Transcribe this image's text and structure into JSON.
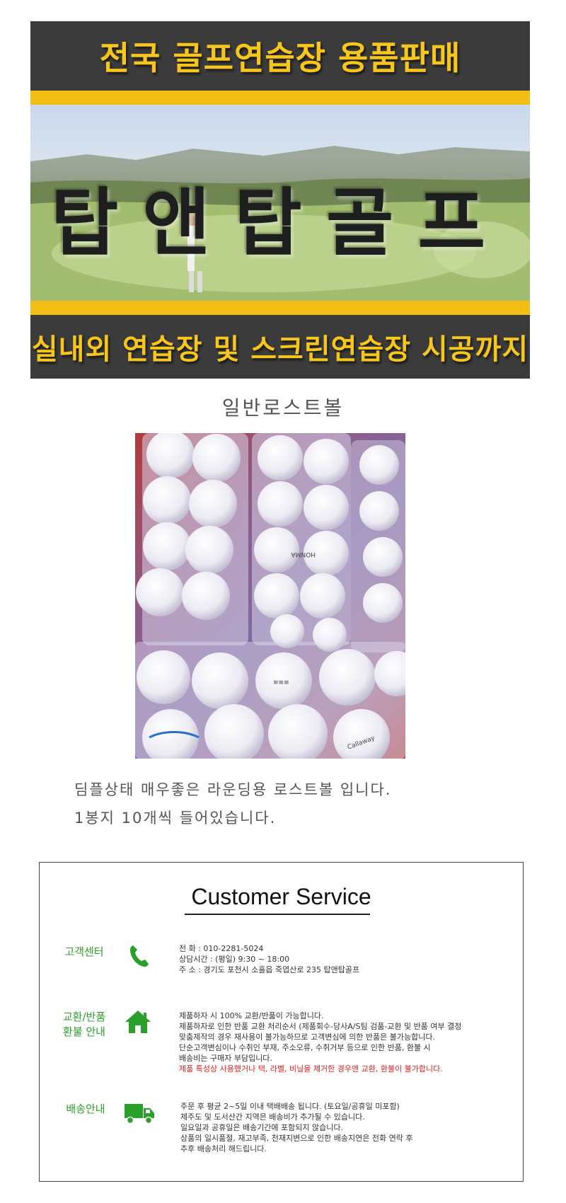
{
  "banner": {
    "top_text": "전국 골프연습장 용품판매",
    "brand": "탑앤탑골프",
    "bottom_text": "실내외 연습장 및 스크린연습장 시공까지"
  },
  "product": {
    "title": "일반로스트볼",
    "description_lines": [
      "딤플상태 매우좋은 라운딩용 로스트볼 입니다.",
      "1봉지 10개씩 들어있습니다."
    ]
  },
  "customer_service": {
    "title": "Customer Service",
    "center": {
      "label": "고객센터",
      "icon": "phone-icon",
      "lines": [
        "전      화 : 010-2281-5024",
        "상담시간 : (평일) 9:30 ~ 18:00",
        "주      소 : 경기도 포천시 소흘읍 죽엽산로 235 탑앤탑골프"
      ]
    },
    "exchange": {
      "label_line1": "교환/반품",
      "label_line2": "환불 안내",
      "icon": "home-icon",
      "lines": [
        "제품하자 시 100% 교환/반품이 가능합니다.",
        "제품하자로 인한 반품 교환 처리순서 (제품회수-당사A/S팀 검품-교환 및 반품 여부 결정",
        "맞춤제작의 경우 재사용이 불가능하므로 고객변심에 의한 반품은 불가능합니다.",
        "단순고객변심이나 수취인 부재, 주소오류, 수취거부 등으로 인한 반품, 환불 시",
        "배송비는 구매자 부담입니다."
      ],
      "warning": "제품 특성상 사용했거나 택, 라벨, 비닐을 제거한 경우엔 교환, 환불이 불가합니다."
    },
    "shipping": {
      "label": "배송안내",
      "icon": "truck-icon",
      "lines": [
        "주문 후 평균 2~5일 이내 택배배송 됩니다. (토요일/공휴일 미포함)",
        "제주도 및 도서산간 지역은 배송비가 추가될 수 있습니다.",
        "일요일과 공휴일은 배송기간에 포함되지 않습니다.",
        "상품의 일시품절, 재고부족, 천재지변으로 인한 배송지연은 전화 연락 후",
        "추후 배송처리 해드립니다."
      ]
    },
    "accent_color": "#2aa02a",
    "warning_color": "#e02020"
  }
}
